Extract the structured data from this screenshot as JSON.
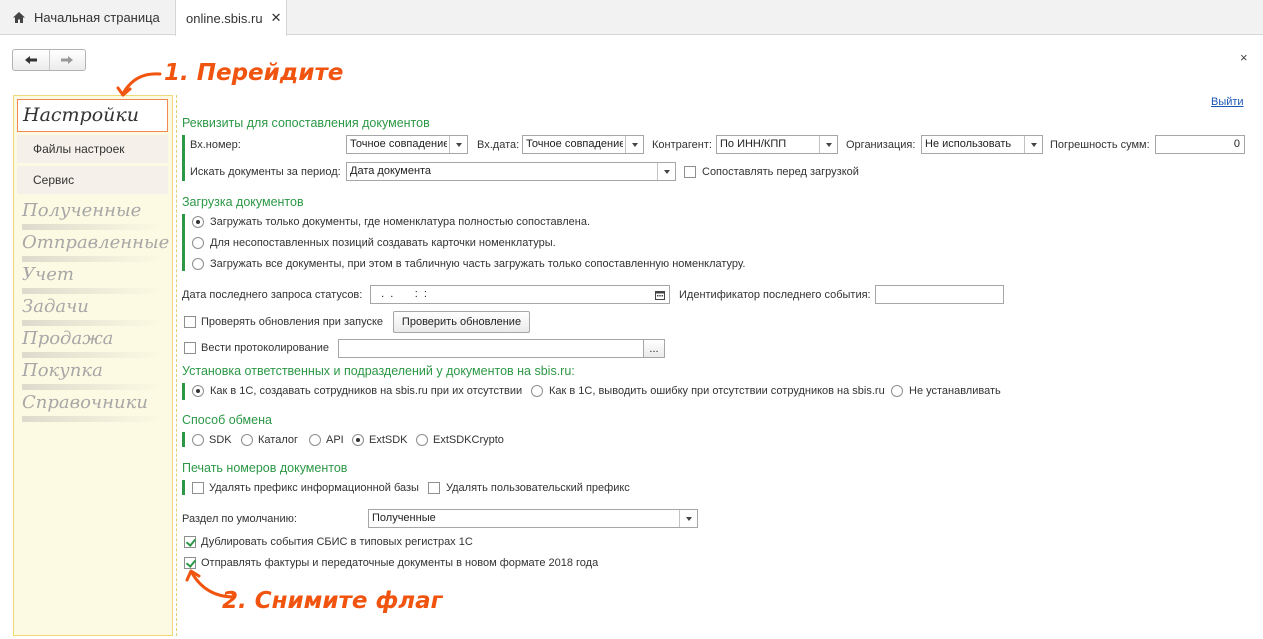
{
  "tabs": {
    "home_label": "Начальная страница",
    "active_label": "online.sbis.ru",
    "close_glyph": "✕"
  },
  "window": {
    "back_glyph": "🡐",
    "forward_glyph": "🡒",
    "close_glyph": "×",
    "exit_label": "Выйти"
  },
  "sidebar": {
    "settings_label": "Настройки",
    "sub_items": [
      "Файлы настроек",
      "Сервис"
    ],
    "sections": [
      "Полученные",
      "Отправленные",
      "Учет",
      "Задачи",
      "Продажа",
      "Покупка",
      "Справочники"
    ]
  },
  "requisites": {
    "heading": "Реквизиты для сопоставления документов",
    "in_number_label": "Вх.номер:",
    "in_number_value": "Точное совпадение",
    "in_date_label": "Вх.дата:",
    "in_date_value": "Точное совпадение",
    "contractor_label": "Контрагент:",
    "contractor_value": "По ИНН/КПП",
    "organization_label": "Организация:",
    "organization_value": "Не использовать",
    "sum_error_label": "Погрешность сумм:",
    "sum_error_value": "0",
    "period_label": "Искать документы за период:",
    "period_value": "Дата документа",
    "compare_before_label": "Сопоставлять перед загрузкой"
  },
  "loading": {
    "heading": "Загрузка документов",
    "options": [
      "Загружать только документы, где номенклатура полностью сопоставлена.",
      "Для несопоставленных позиций создавать карточки номенклатуры.",
      "Загружать все документы, при этом в табличную часть загружать только сопоставленную номенклатуру."
    ],
    "selected": 0
  },
  "status": {
    "last_request_label": "Дата последнего запроса статусов:",
    "last_request_value": "  .  .       :  :",
    "last_event_label": "Идентификатор последнего события:",
    "last_event_value": "",
    "check_updates_label": "Проверять обновления при запуске",
    "check_update_button": "Проверить обновление",
    "logging_label": "Вести протоколирование",
    "logging_value": "",
    "browse_glyph": "..."
  },
  "responsible": {
    "heading": "Установка ответственных и подразделений у документов на sbis.ru:",
    "options": [
      "Как в 1С, создавать сотрудников на sbis.ru при их отсутствии",
      "Как в 1С, выводить ошибку при отсутствии сотрудников на sbis.ru",
      "Не устанавливать"
    ],
    "selected": 0
  },
  "exchange": {
    "heading": "Способ обмена",
    "options": [
      "SDK",
      "Каталог",
      "API",
      "ExtSDK",
      "ExtSDKCrypto"
    ],
    "selected": 3
  },
  "print_numbers": {
    "heading": "Печать номеров документов",
    "remove_infobase_prefix": "Удалять префикс информационной базы",
    "remove_user_prefix": "Удалять пользовательский префикс"
  },
  "defaults": {
    "section_label": "Раздел по умолчанию:",
    "section_value": "Полученные",
    "duplicate_events_label": "Дублировать события СБИС в типовых регистрах 1С",
    "send_invoices_label": "Отправлять фактуры и передаточные документы в новом формате 2018 года"
  },
  "annotations": {
    "step1": "1. Перейдите",
    "step2": "2. Снимите флаг"
  },
  "colors": {
    "accent_green": "#2c9846",
    "annotation_orange": "#f0540f",
    "sidebar_bg": "#fdfae3"
  }
}
